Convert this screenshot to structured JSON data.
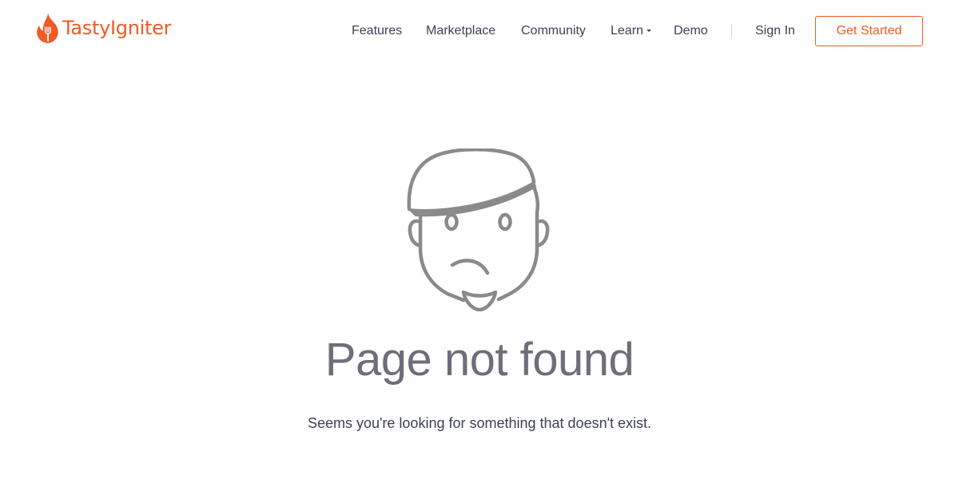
{
  "brand": {
    "name": "TastyIgniter",
    "accent_color": "#f15a24",
    "icon": "flame-fork-icon"
  },
  "nav": {
    "items": [
      {
        "label": "Features"
      },
      {
        "label": "Marketplace"
      },
      {
        "label": "Community"
      },
      {
        "label": "Learn",
        "has_dropdown": true
      },
      {
        "label": "Demo"
      }
    ],
    "sign_in": "Sign In",
    "get_started": "Get Started"
  },
  "main": {
    "illustration": "sad-face-icon",
    "title": "Page not found",
    "message": "Seems you're looking for something that doesn't exist."
  }
}
